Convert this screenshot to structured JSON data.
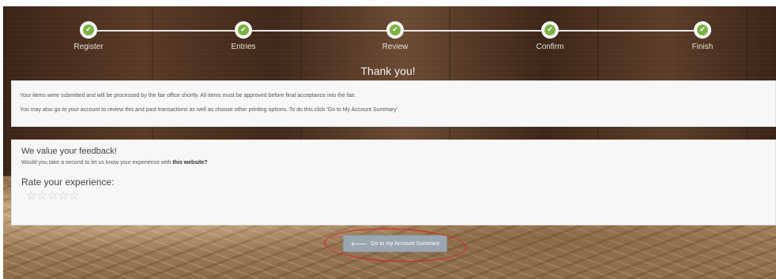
{
  "progress": {
    "steps": [
      {
        "label": "Register",
        "icon": "check-icon",
        "check": "✔"
      },
      {
        "label": "Entries",
        "icon": "check-icon",
        "check": "✔"
      },
      {
        "label": "Review",
        "icon": "check-icon",
        "check": "✔"
      },
      {
        "label": "Confirm",
        "icon": "check-icon",
        "check": "✔"
      },
      {
        "label": "Finish",
        "icon": "check-icon",
        "check": "✔"
      }
    ],
    "completed_color": "#7cb342"
  },
  "confirmation": {
    "title": "Thank you!",
    "line1": "Your items were submitted and will be processed by the fair office shortly. All items must be approved before final acceptance into the fair.",
    "line2": "You may also go to your account to review this and past transactions as well as choose other printing options. To do this click 'Go to My Account Summary'."
  },
  "feedback": {
    "heading": "We value your feedback!",
    "question_prefix": "Would you take a second to let us know your experience with ",
    "question_bold": "this website?",
    "rate_heading": "Rate your experience:",
    "stars": [
      "☆",
      "☆",
      "☆",
      "☆",
      "☆"
    ],
    "rating": 0
  },
  "account_button": {
    "icon": "arrow-left-icon",
    "arrow": "🡐",
    "label": "Go to my Account Summary"
  },
  "colors": {
    "button": "#9aa7b1",
    "annotation": "#d62020"
  }
}
